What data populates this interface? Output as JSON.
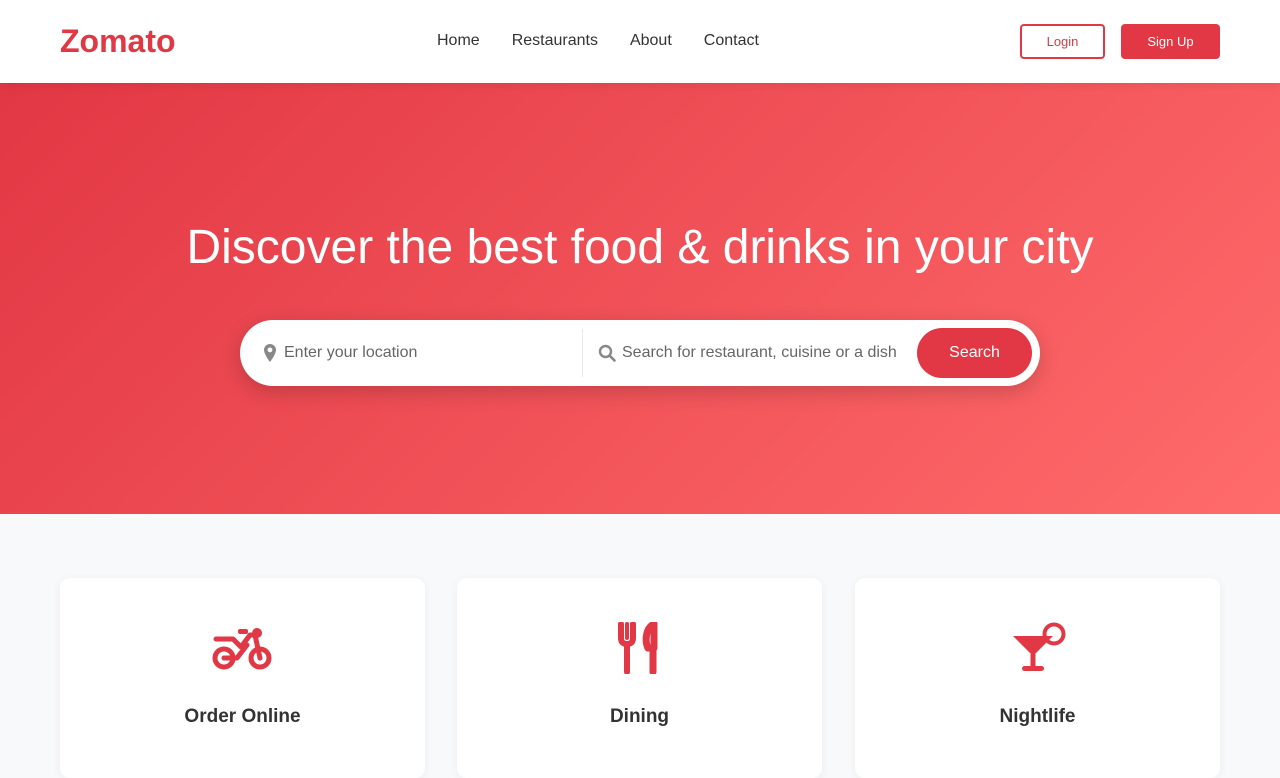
{
  "brand": {
    "name": "Zomato",
    "color": "#e23744"
  },
  "nav": {
    "items": [
      {
        "label": "Home"
      },
      {
        "label": "Restaurants"
      },
      {
        "label": "About"
      },
      {
        "label": "Contact"
      }
    ]
  },
  "auth": {
    "login_label": "Login",
    "signup_label": "Sign Up"
  },
  "hero": {
    "title": "Discover the best food & drinks in your city",
    "gradient": [
      "#e23744",
      "#ff6b6b"
    ],
    "search": {
      "location_placeholder": "Enter your location",
      "location_icon": "map-pin-icon",
      "query_placeholder": "Search for restaurant, cuisine or a dish",
      "query_icon": "search-icon",
      "button_label": "Search"
    }
  },
  "features": [
    {
      "icon": "motorcycle-icon",
      "title": "Order Online"
    },
    {
      "icon": "utensils-icon",
      "title": "Dining"
    },
    {
      "icon": "cocktail-icon",
      "title": "Nightlife"
    }
  ]
}
